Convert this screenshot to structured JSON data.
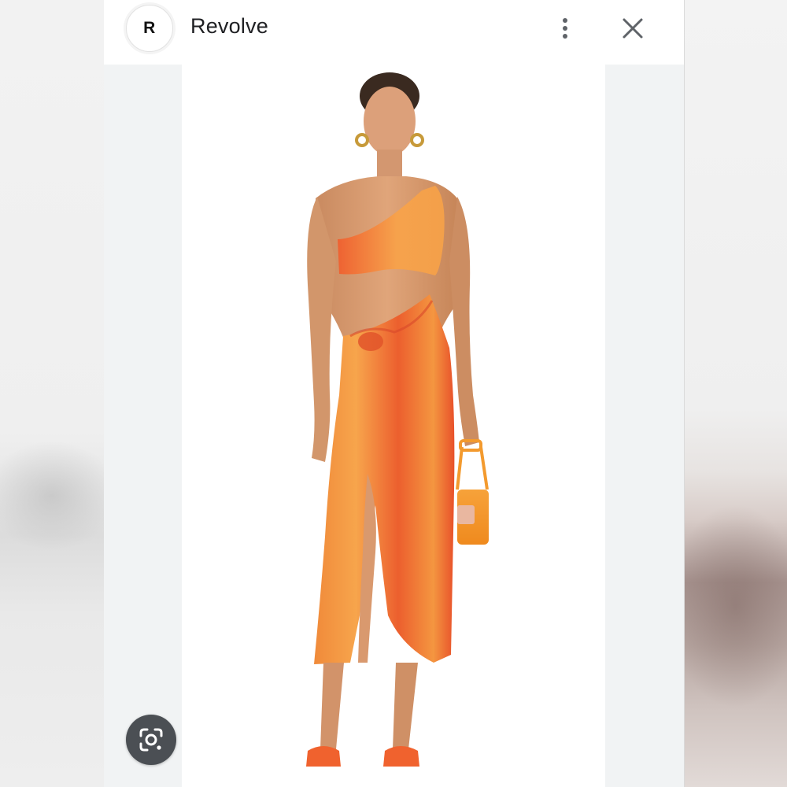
{
  "header": {
    "site_initial": "R",
    "site_name": "Revolve",
    "more_icon": "more-vert-icon",
    "close_icon": "close-icon"
  },
  "viewer": {
    "image_subject": "product-photo",
    "lens_icon": "google-lens-icon"
  },
  "colors": {
    "dress_dark": "#e8502a",
    "dress_light": "#f7a74a",
    "page_bg": "#f1f3f4"
  }
}
